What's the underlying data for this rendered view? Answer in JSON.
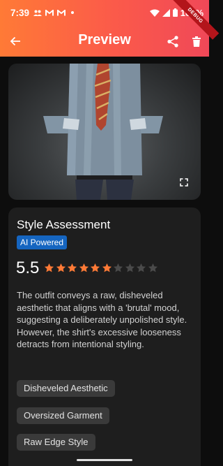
{
  "status_bar": {
    "time": "7:39",
    "left_icons": [
      "group-icon",
      "mail-icon",
      "mail-icon",
      "dot-icon"
    ],
    "battery": "100%",
    "right_icons": [
      "wifi-icon",
      "signal-icon",
      "battery-icon"
    ]
  },
  "toolbar": {
    "title": "Preview",
    "back_icon": "arrow-back-icon",
    "share_icon": "share-icon",
    "delete_icon": "delete-icon",
    "debug_label": "DEBUG"
  },
  "photo": {
    "expand_icon": "fullscreen-icon"
  },
  "assessment": {
    "title": "Style Assessment",
    "badge": "AI Powered",
    "score": "5.5",
    "rating_filled": 6,
    "rating_max": 10,
    "description": "The outfit conveys a raw, disheveled aesthetic that aligns with a 'brutal' mood, suggesting a deliberately unpolished style. However, the shirt's excessive looseness detracts from intentional styling.",
    "tags": [
      "Disheveled Aesthetic",
      "Oversized Garment",
      "Raw Edge Style"
    ]
  },
  "colors": {
    "accent_start": "#ff7a36",
    "accent_end": "#f04858",
    "star_filled": "#ff7a36",
    "star_empty": "#4a4a4a",
    "badge": "#1565c0",
    "card_bg": "#1e1e1e",
    "page_bg": "#0d0d0d"
  }
}
